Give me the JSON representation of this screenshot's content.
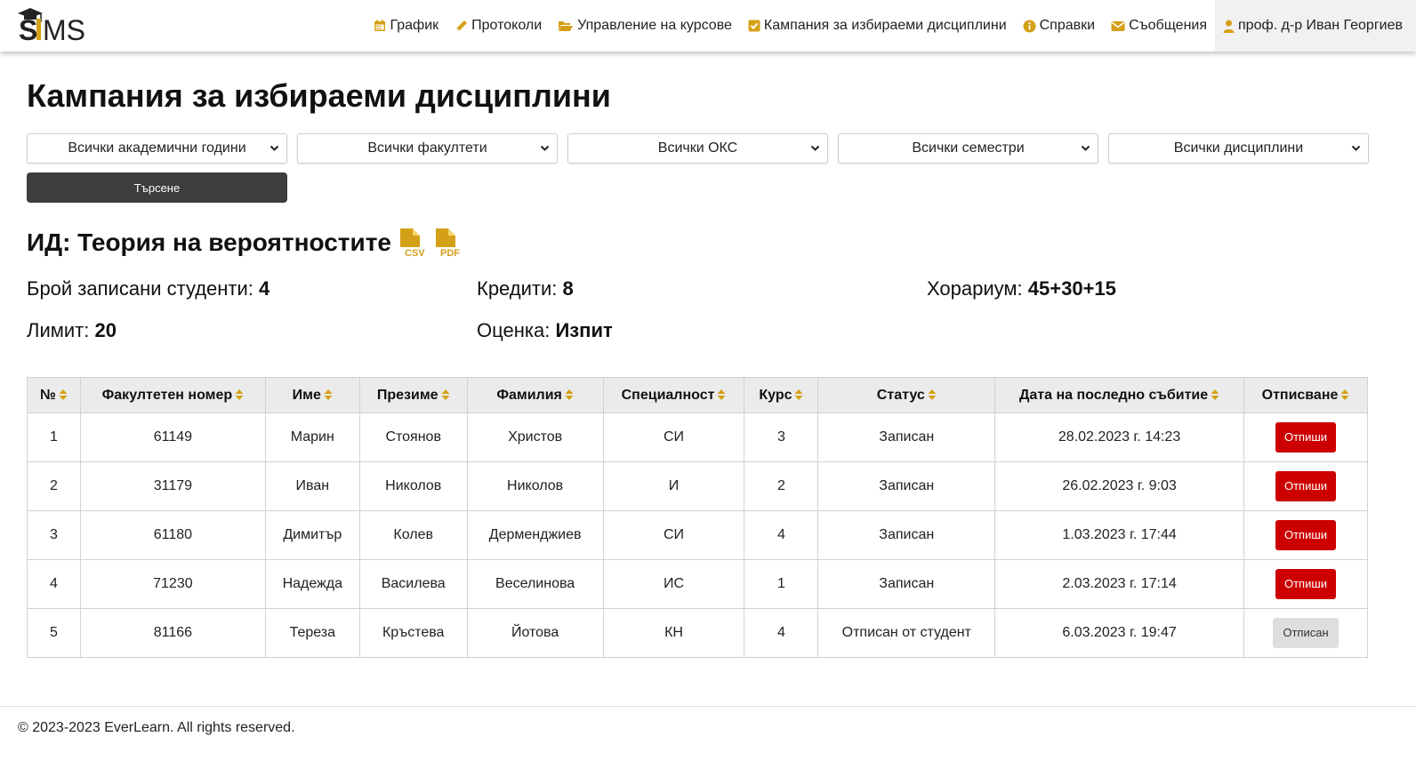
{
  "brand": {
    "logo_text": "SIMS"
  },
  "colors": {
    "accent": "#d4a017",
    "danger": "#cc0000",
    "dark_button": "#3d3d3d"
  },
  "nav": {
    "items": [
      {
        "label": "График",
        "icon": "calendar-icon"
      },
      {
        "label": "Протоколи",
        "icon": "pencil-icon"
      },
      {
        "label": "Управление на курсове",
        "icon": "folder-open-icon"
      },
      {
        "label": "Кампания за избираеми дисциплини",
        "icon": "check-square-icon"
      },
      {
        "label": "Справки",
        "icon": "info-circle-icon"
      },
      {
        "label": "Съобщения",
        "icon": "envelope-icon"
      }
    ],
    "user": {
      "label": "проф. д-р Иван Георгиев",
      "icon": "user-icon"
    }
  },
  "page_title": "Кампания за избираеми дисциплини",
  "filters": {
    "academic_year": "Всички академични години",
    "faculty": "Всички факултети",
    "degree": "Всички ОКС",
    "semester": "Всички семестри",
    "discipline": "Всички дисциплини",
    "search_label": "Търсене"
  },
  "discipline": {
    "title": "ИД: Теория на вероятностите",
    "export_icons": [
      "csv-file-icon",
      "pdf-file-icon"
    ],
    "enrolled_label": "Брой записани студенти:",
    "enrolled_value": "4",
    "credits_label": "Кредити:",
    "credits_value": "8",
    "hours_label": "Хорариум:",
    "hours_value": "45+30+15",
    "limit_label": "Лимит:",
    "limit_value": "20",
    "grading_label": "Оценка:",
    "grading_value": "Изпит"
  },
  "table": {
    "columns": [
      "№",
      "Факултетен номер",
      "Име",
      "Презиме",
      "Фамилия",
      "Специалност",
      "Курс",
      "Статус",
      "Дата на последно събитие",
      "Отписване"
    ],
    "rows": [
      {
        "n": "1",
        "fn": "61149",
        "first": "Марин",
        "middle": "Стоянов",
        "last": "Христов",
        "spec": "СИ",
        "year": "3",
        "status": "Записан",
        "date": "28.02.2023 г. 14:23",
        "action": "Отпиши"
      },
      {
        "n": "2",
        "fn": "31179",
        "first": "Иван",
        "middle": "Николов",
        "last": "Николов",
        "spec": "И",
        "year": "2",
        "status": "Записан",
        "date": "26.02.2023 г. 9:03",
        "action": "Отпиши"
      },
      {
        "n": "3",
        "fn": "61180",
        "first": "Димитър",
        "middle": "Колев",
        "last": "Дерменджиев",
        "spec": "СИ",
        "year": "4",
        "status": "Записан",
        "date": "1.03.2023 г. 17:44",
        "action": "Отпиши"
      },
      {
        "n": "4",
        "fn": "71230",
        "first": "Надежда",
        "middle": "Василева",
        "last": "Веселинова",
        "spec": "ИС",
        "year": "1",
        "status": "Записан",
        "date": "2.03.2023 г. 17:14",
        "action": "Отпиши"
      },
      {
        "n": "5",
        "fn": "81166",
        "first": "Тереза",
        "middle": "Кръстева",
        "last": "Йотова",
        "spec": "КН",
        "year": "4",
        "status": "Отписан от студент",
        "date": "6.03.2023 г. 19:47",
        "action": "Отписан"
      }
    ]
  },
  "footer": "© 2023-2023 EverLearn. All rights reserved."
}
